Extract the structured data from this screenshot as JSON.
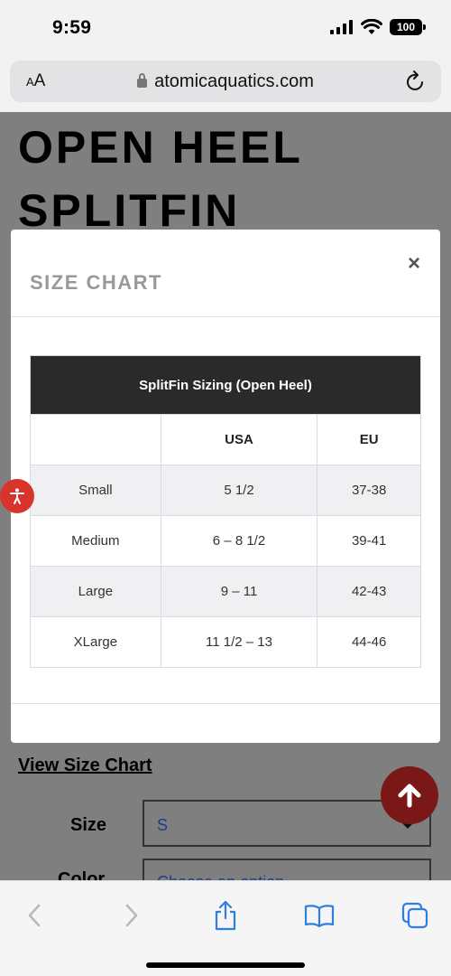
{
  "status_bar": {
    "time": "9:59",
    "battery": "100"
  },
  "browser": {
    "aa_label_small": "A",
    "aa_label_large": "A",
    "url": "atomicaquatics.com"
  },
  "page": {
    "product_title": "OPEN HEEL SPLITFIN",
    "view_size_chart_link": "View Size Chart",
    "size_label": "Size",
    "size_value": "S",
    "color_label": "Color",
    "color_value": "Choose an option"
  },
  "modal": {
    "title": "SIZE CHART",
    "close_label": "×",
    "table": {
      "caption": "SplitFin Sizing (Open Heel)",
      "headers": [
        "",
        "USA",
        "EU"
      ],
      "rows": [
        [
          "Small",
          "5 1/2",
          "37-38"
        ],
        [
          "Medium",
          "6 – 8 1/2",
          "39-41"
        ],
        [
          "Large",
          "9 – 11",
          "42-43"
        ],
        [
          "XLarge",
          "11 1/2 – 13",
          "44-46"
        ]
      ]
    }
  },
  "colors": {
    "accent_red": "#d9342b",
    "scroll_top_bg": "#7a1818",
    "table_header_bg": "#2a2a2a",
    "link_blue": "#1d3f8a"
  }
}
